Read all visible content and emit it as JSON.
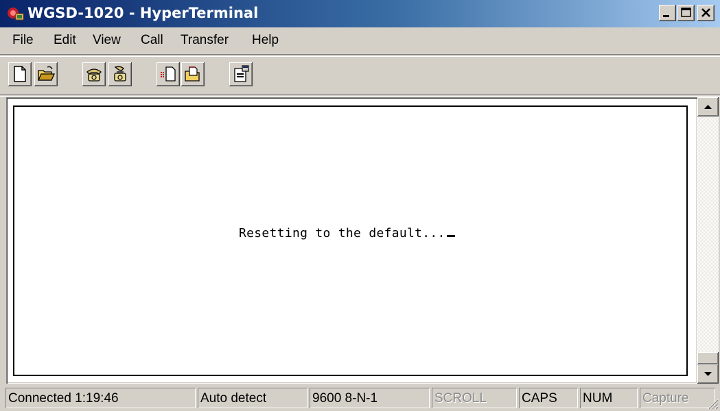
{
  "window": {
    "title": "WGSD-1020 - HyperTerminal",
    "controls": {
      "minimize": "minimize",
      "restore": "restore",
      "close": "close"
    }
  },
  "menu": [
    "File",
    "Edit",
    "View",
    "Call",
    "Transfer",
    "Help"
  ],
  "toolbar": {
    "buttons": [
      {
        "icon": "new-document-icon"
      },
      {
        "icon": "open-folder-icon"
      },
      {
        "icon": "phone-connect-icon"
      },
      {
        "icon": "phone-disconnect-icon"
      },
      {
        "icon": "send-file-icon"
      },
      {
        "icon": "receive-file-icon"
      },
      {
        "icon": "properties-icon"
      }
    ]
  },
  "terminal": {
    "text": "Resetting to the default..."
  },
  "status": {
    "connection": "Connected 1:19:46",
    "emulation": "Auto detect",
    "settings": "9600 8-N-1",
    "scroll": "SCROLL",
    "caps": "CAPS",
    "num": "NUM",
    "capture": "Capture"
  },
  "colors": {
    "titlebar_start": "#0a246a",
    "titlebar_end": "#a6caf0",
    "face": "#d4d0c8",
    "terminal_bg": "#ffffff",
    "dim_text": "#8c8c8c"
  }
}
